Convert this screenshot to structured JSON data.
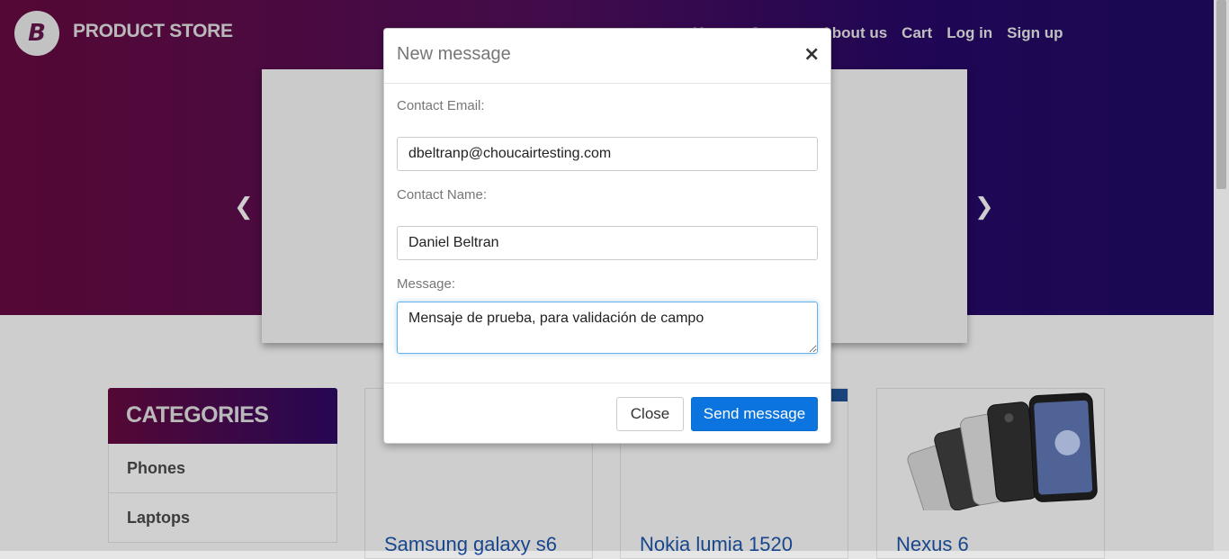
{
  "navbar": {
    "logo_letter": "B",
    "brand": "PRODUCT STORE",
    "links": [
      "Home",
      "Contact",
      "About us",
      "Cart",
      "Log in",
      "Sign up"
    ]
  },
  "carousel": {
    "prev_icon": "chevron-left-icon",
    "next_icon": "chevron-right-icon"
  },
  "categories": {
    "header": "CATEGORIES",
    "items": [
      "Phones",
      "Laptops"
    ]
  },
  "products": [
    "Samsung galaxy s6",
    "Nokia lumia 1520",
    "Nexus 6"
  ],
  "modal": {
    "title": "New message",
    "close_symbol": "×",
    "email_label": "Contact Email:",
    "email_value": "dbeltranp@choucairtesting.com",
    "name_label": "Contact Name:",
    "name_value": "Daniel Beltran",
    "message_label": "Message:",
    "message_value": "Mensaje de prueba, para validación de campo",
    "close_button": "Close",
    "send_button": "Send message"
  },
  "colors": {
    "hero_start": "#5e0a3b",
    "hero_end": "#1d0a5c",
    "primary_button": "#0b74de",
    "product_link": "#1b4f9c"
  }
}
